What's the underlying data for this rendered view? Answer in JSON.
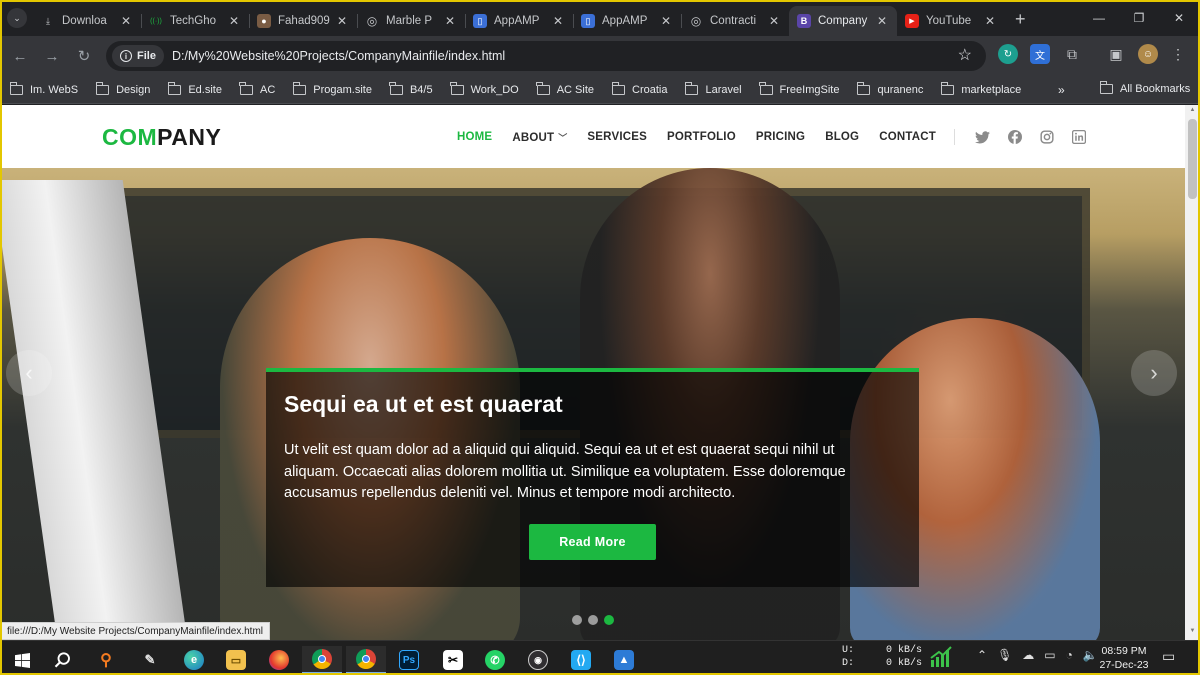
{
  "browser": {
    "tabs": [
      {
        "title": "Downloa",
        "icon": "download-icon",
        "color": "#9aa0a6",
        "glyph": "⤓"
      },
      {
        "title": "TechGho",
        "icon": "techghor-icon",
        "color": "#1cb841",
        "glyph": "((·))"
      },
      {
        "title": "Fahad909",
        "icon": "avatar-icon",
        "color": "#7a5c44",
        "glyph": "●"
      },
      {
        "title": "Marble P",
        "icon": "globe-icon",
        "color": "#9aa0a6",
        "glyph": "◎"
      },
      {
        "title": "AppAMP",
        "icon": "appamp-icon",
        "color": "#3b6fd6",
        "glyph": "▯"
      },
      {
        "title": "AppAMP",
        "icon": "appamp-icon",
        "color": "#3b6fd6",
        "glyph": "▯"
      },
      {
        "title": "Contracti",
        "icon": "globe-icon",
        "color": "#9aa0a6",
        "glyph": "◎"
      },
      {
        "title": "Company",
        "icon": "bootstrap-icon",
        "color": "#5a45a8",
        "glyph": "B",
        "active": true
      },
      {
        "title": "YouTube",
        "icon": "youtube-icon",
        "color": "#e62117",
        "glyph": "▶"
      }
    ],
    "file_chip": "File",
    "url": "D:/My%20Website%20Projects/CompanyMainfile/index.html",
    "status_url": "file:///D:/My Website Projects/CompanyMainfile/index.html",
    "bookmarks": [
      "Im. WebS",
      "Design",
      "Ed.site",
      "AC",
      "Progam.site",
      "B4/5",
      "Work_DO",
      "AC Site",
      "Croatia",
      "Laravel",
      "FreeImgSite",
      "quranenc",
      "marketplace"
    ],
    "bookmarks_more": "»",
    "all_bookmarks": "All Bookmarks"
  },
  "site": {
    "logo_accent": "COM",
    "logo_rest": "PANY",
    "nav": [
      "HOME",
      "ABOUT",
      "SERVICES",
      "PORTFOLIO",
      "PRICING",
      "BLOG",
      "CONTACT"
    ],
    "active_nav": "HOME",
    "accent_color": "#1cb841",
    "social": [
      "twitter-icon",
      "facebook-icon",
      "instagram-icon",
      "linkedin-icon"
    ]
  },
  "hero": {
    "title": "Sequi ea ut et est quaerat",
    "body": "Ut velit est quam dolor ad a aliquid qui aliquid. Sequi ea ut et est quaerat sequi nihil ut aliquam. Occaecati alias dolorem mollitia ut. Similique ea voluptatem. Esse doloremque accusamus repellendus deleniti vel. Minus et tempore modi architecto.",
    "button": "Read More",
    "slides": 3,
    "active_slide": 3
  },
  "taskbar": {
    "net_up_label": "U:",
    "net_up_value": "0 kB/s",
    "net_down_label": "D:",
    "net_down_value": "0 kB/s",
    "time": "08:59 PM",
    "date": "27-Dec-23"
  }
}
